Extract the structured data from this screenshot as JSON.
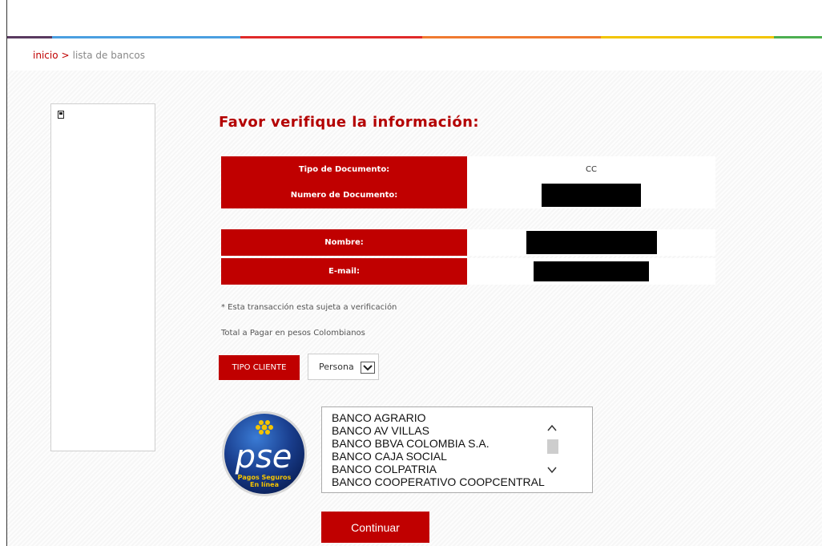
{
  "breadcrumb": {
    "home": "inicio",
    "separator": ">",
    "current": "lista de bancos"
  },
  "colors": {
    "brand_red": "#c00000",
    "title_red": "#b40000",
    "stripe": [
      "#5a3a60",
      "#4a9fe0",
      "#e02a2a",
      "#f07a30",
      "#f2c400",
      "#4caf50"
    ]
  },
  "title": "Favor verifique la información:",
  "fields": [
    {
      "label": "Tipo de Documento:",
      "value": "CC",
      "redacted": false
    },
    {
      "label": "Numero de Documento:",
      "value": "",
      "redacted": true
    },
    {
      "label": "Nombre:",
      "value": "",
      "redacted": true
    },
    {
      "label": "E-mail:",
      "value": "",
      "redacted": true
    }
  ],
  "notes": {
    "verification": "* Esta transacción esta sujeta a verificación",
    "total": "Total a Pagar en pesos Colombianos"
  },
  "tipo_cliente": {
    "label": "TIPO CLIENTE",
    "selected": "Persona"
  },
  "pse_logo": {
    "text": "pse",
    "tagline_1": "Pagos Seguros",
    "tagline_2": "En línea"
  },
  "banks": [
    "BANCO AGRARIO",
    "BANCO AV VILLAS",
    "BANCO BBVA COLOMBIA S.A.",
    "BANCO CAJA SOCIAL",
    "BANCO COLPATRIA",
    "BANCO COOPERATIVO COOPCENTRAL"
  ],
  "continue_label": "Continuar",
  "icons": {
    "broken_image": "broken-image-icon",
    "select_arrow": "chevron-down-icon",
    "scroll_up": "chevron-up-icon",
    "scroll_down": "chevron-down-icon"
  }
}
